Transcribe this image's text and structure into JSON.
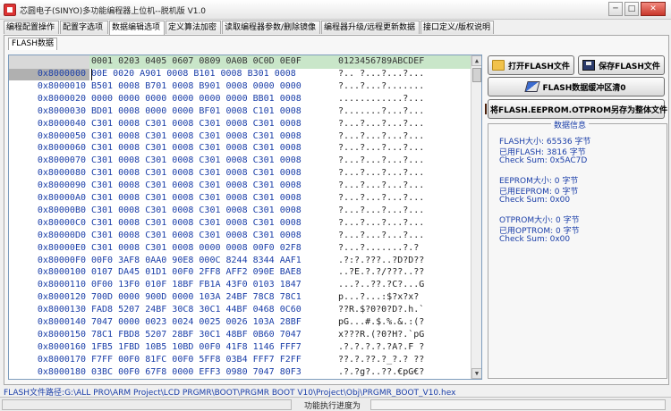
{
  "window": {
    "title": "芯圆电子(SINYO)多功能编程器上位机--脱机版 V1.0"
  },
  "tabs": [
    "编程配置操作",
    "配置字选项",
    "数据编辑选项",
    "定义算法加密",
    "读取编程器参数/删除镜像",
    "编程器升级/远程更新数据",
    "接口定义/版权说明"
  ],
  "active_tab": "数据编辑选项",
  "subtab": "FLASH数据",
  "hex": {
    "header": "0001 0203 0405 0607 0809 0A0B 0C0D 0E0F",
    "ascii_header": "0123456789ABCDEF",
    "rows": [
      {
        "addr": "0x8000000",
        "data": "00E 0020 A901 0008 B101 0008 B301 0008",
        "ascii": "?.. ?...?...?..."
      },
      {
        "addr": "0x8000010",
        "data": "B501 0008 B701 0008 B901 0008 0000 0000",
        "ascii": "?...?...?......."
      },
      {
        "addr": "0x8000020",
        "data": "0000 0000 0000 0000 0000 0000 BB01 0008",
        "ascii": "............?..."
      },
      {
        "addr": "0x8000030",
        "data": "BD01 0008 0000 0000 BF01 0008 C101 0008",
        "ascii": "?.......?...?..."
      },
      {
        "addr": "0x8000040",
        "data": "C301 0008 C301 0008 C301 0008 C301 0008",
        "ascii": "?...?...?...?..."
      },
      {
        "addr": "0x8000050",
        "data": "C301 0008 C301 0008 C301 0008 C301 0008",
        "ascii": "?...?...?...?..."
      },
      {
        "addr": "0x8000060",
        "data": "C301 0008 C301 0008 C301 0008 C301 0008",
        "ascii": "?...?...?...?..."
      },
      {
        "addr": "0x8000070",
        "data": "C301 0008 C301 0008 C301 0008 C301 0008",
        "ascii": "?...?...?...?..."
      },
      {
        "addr": "0x8000080",
        "data": "C301 0008 C301 0008 C301 0008 C301 0008",
        "ascii": "?...?...?...?..."
      },
      {
        "addr": "0x8000090",
        "data": "C301 0008 C301 0008 C301 0008 C301 0008",
        "ascii": "?...?...?...?..."
      },
      {
        "addr": "0x80000A0",
        "data": "C301 0008 C301 0008 C301 0008 C301 0008",
        "ascii": "?...?...?...?..."
      },
      {
        "addr": "0x80000B0",
        "data": "C301 0008 C301 0008 C301 0008 C301 0008",
        "ascii": "?...?...?...?..."
      },
      {
        "addr": "0x80000C0",
        "data": "C301 0008 C301 0008 C301 0008 C301 0008",
        "ascii": "?...?...?...?..."
      },
      {
        "addr": "0x80000D0",
        "data": "C301 0008 C301 0008 C301 0008 C301 0008",
        "ascii": "?...?...?...?..."
      },
      {
        "addr": "0x80000E0",
        "data": "C301 0008 C301 0008 0000 0008 00F0 02F8",
        "ascii": "?...?.......?.?"
      },
      {
        "addr": "0x80000F0",
        "data": "00F0 3AF8 0AA0 90E8 000C 8244 8344 AAF1",
        "ascii": ".?:?.???..?D?D??"
      },
      {
        "addr": "0x8000100",
        "data": "0107 DA45 01D1 00F0 2FF8 AFF2 090E BAE8",
        "ascii": "..?E.?.?/???..??"
      },
      {
        "addr": "0x8000110",
        "data": "0F00 13F0 010F 18BF FB1A 43F0 0103 1847",
        "ascii": "...?..??.?C?...G"
      },
      {
        "addr": "0x8000120",
        "data": "700D 0000 900D 0000 103A 24BF 78C8 78C1",
        "ascii": "p...?...:$?x?x?"
      },
      {
        "addr": "0x8000130",
        "data": "FAD8 5207 24BF 30C8 30C1 44BF 0468 0C60",
        "ascii": "??R.$?0?0?D?.h.`"
      },
      {
        "addr": "0x8000140",
        "data": "7047 0000 0023 0024 0025 0026 103A 28BF",
        "ascii": "pG...#.$.%.&.:(?"
      },
      {
        "addr": "0x8000150",
        "data": "78C1 FBD8 5207 28BF 30C1 48BF 0B60 7047",
        "ascii": "x???R.(?0?H?.`pG"
      },
      {
        "addr": "0x8000160",
        "data": "1FB5 1FBD 10B5 10BD 00F0 41F8 1146 FFF7",
        "ascii": ".?.?.?.?.?A?.F ?"
      },
      {
        "addr": "0x8000170",
        "data": "F7FF 00F0 81FC 00F0 5FF8 03B4 FFF7 F2FF",
        "ascii": "??.?.??.?_?.? ??"
      },
      {
        "addr": "0x8000180",
        "data": "03BC 00F0 67F8 0000 EFF3 0980 7047 80F3",
        "ascii": ".?.?g?..??.€pG€?"
      }
    ]
  },
  "buttons": {
    "open_flash": "打开FLASH文件",
    "save_flash": "保存FLASH文件",
    "clear_buffer": "FLASH数据缓冲区清0",
    "save_all": "将FLASH.EEPROM.OTPROM另存为整体文件"
  },
  "info": {
    "title": "数据信息",
    "flash_size": "FLASH大小:    65536 字节",
    "flash_used": "已用FLASH:     3816 字节",
    "flash_checksum": "Check Sum: 0x5AC7D",
    "eeprom_size": "EEPROM大小:  0 字节",
    "eeprom_used": "已用EEPROM:  0 字节",
    "eeprom_checksum": "Check Sum: 0x00",
    "otprom_size": "OTPROM大小: 0 字节",
    "otprom_used": "已用OPTROM: 0 字节",
    "otprom_checksum": "Check Sum: 0x00"
  },
  "path": "FLASH文件路径:G:\\ALL PRO\\ARM Project\\LCD PRGMR\\BOOT\\PRGMR BOOT V10\\Project\\Obj\\PRGMR_BOOT_V10.hex",
  "status": {
    "progress_label": "功能执行进度为"
  },
  "window_controls": {
    "minimize": "─",
    "maximize": "□",
    "close": "✕"
  }
}
